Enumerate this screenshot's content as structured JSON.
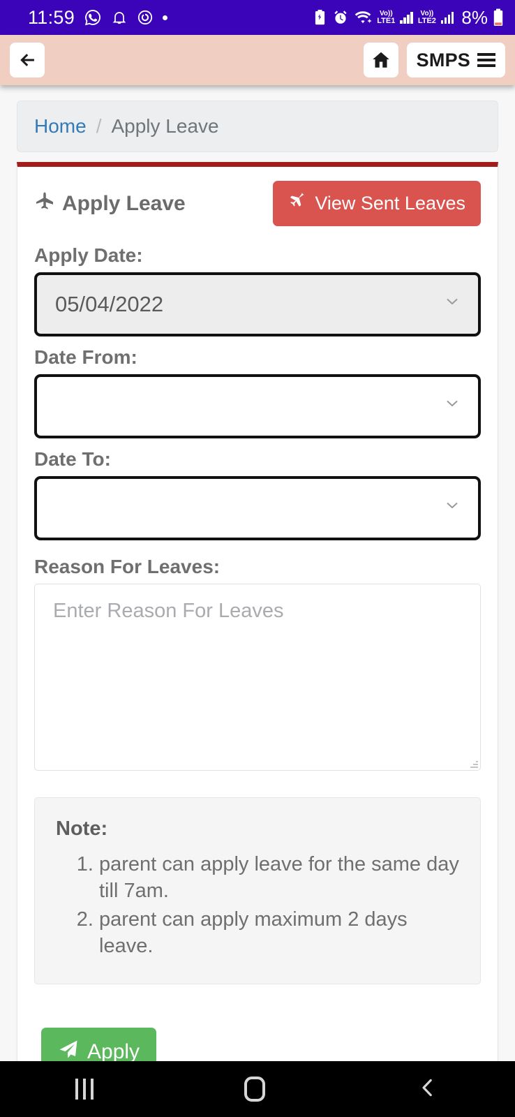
{
  "status_bar": {
    "time": "11:59",
    "battery_percent": "8%",
    "left_icons": [
      "whatsapp-icon",
      "bell-icon",
      "clock-app-icon",
      "dot-indicator"
    ],
    "right_icons": [
      "battery-saver-icon",
      "alarm-icon",
      "wifi-icon",
      "volte1-icon",
      "signal1-icon",
      "volte2-icon",
      "signal2-icon",
      "battery-icon"
    ],
    "sim1_label_top": "Vo))",
    "sim1_label_bottom": "LTE1",
    "sim2_label_top": "Vo))",
    "sim2_label_bottom": "LTE2",
    "background_color": "#3b04b8"
  },
  "app_bar": {
    "back_icon": "arrow-left-icon",
    "home_icon": "home-icon",
    "brand_label": "SMPS",
    "menu_icon": "hamburger-menu-icon",
    "background_color": "#f0cec1"
  },
  "breadcrumb": {
    "home_label": "Home",
    "separator": "/",
    "current_label": "Apply Leave"
  },
  "card": {
    "top_border_color": "#a31d1d",
    "title": "Apply Leave",
    "title_icon": "airplane-up-icon",
    "view_sent_button": {
      "label": "View Sent Leaves",
      "icon": "airplane-icon",
      "color": "#d9534f"
    },
    "fields": {
      "apply_date": {
        "label": "Apply Date:",
        "value": "05/04/2022",
        "disabled": true
      },
      "date_from": {
        "label": "Date From:",
        "value": ""
      },
      "date_to": {
        "label": "Date To:",
        "value": ""
      },
      "reason": {
        "label": "Reason For Leaves:",
        "value": "",
        "placeholder": "Enter Reason For Leaves"
      }
    },
    "note": {
      "title": "Note:",
      "items": [
        "parent can apply leave for the same day till 7am.",
        "parent can apply maximum 2 days leave."
      ]
    },
    "apply_button": {
      "label": "Apply",
      "icon": "paper-plane-icon",
      "color": "#5cb85c"
    }
  },
  "nav_bar": {
    "recents_icon": "recents-icon",
    "home_icon": "home-circle-icon",
    "back_icon": "chevron-left-icon"
  }
}
